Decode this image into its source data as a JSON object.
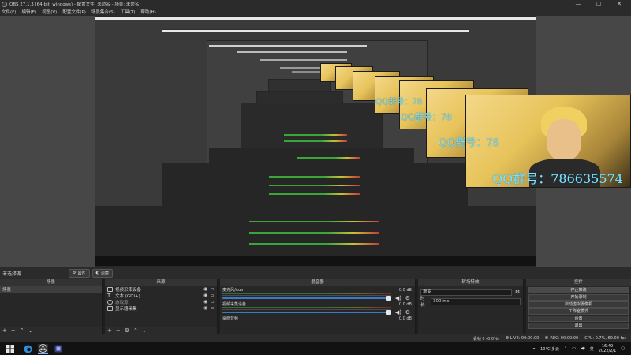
{
  "window": {
    "title": "OBS 27.1.3 (64-bit, windows) - 配置文件: 未命名 - 场景: 未命名",
    "minimize": "—",
    "maximize": "☐",
    "close": "✕"
  },
  "menu": [
    "文件(F)",
    "编辑(E)",
    "视图(V)",
    "配置文件(P)",
    "场景集合(S)",
    "工具(T)",
    "帮助(H)"
  ],
  "preview": {
    "overlay_texts": [
      "QQ群号：78",
      "QQ群号：78",
      "QQ群号：78",
      "QQ群号：786635574"
    ]
  },
  "scene_bar": {
    "name": "未选择源",
    "properties_label": "属性",
    "filters_label": "滤镜"
  },
  "scenes": {
    "header": "场景",
    "items": [
      "场景"
    ]
  },
  "sources": {
    "header": "来源",
    "items": [
      {
        "name": "视频采集设备",
        "icon": "camera-icon"
      },
      {
        "name": "文本 (GDI+)",
        "icon": "text-icon"
      },
      {
        "name": "游戏源",
        "icon": "gamepad-icon"
      },
      {
        "name": "显示器采集",
        "icon": "monitor-icon"
      }
    ]
  },
  "mixer": {
    "header": "混音器",
    "tracks": [
      {
        "name": "麦克风/Aux",
        "db": "0.0 dB",
        "level": 0.7
      },
      {
        "name": "视频采集设备",
        "db": "0.0 dB",
        "level": 0.7
      },
      {
        "name": "桌面音频",
        "db": "0.0 dB",
        "level": 0.7
      }
    ]
  },
  "transitions": {
    "header": "转场特效",
    "type": "渐变",
    "duration_label": "时长",
    "duration_value": "300 ms"
  },
  "controls": {
    "header": "控件",
    "buttons": [
      "停止推流",
      "开始录制",
      "启动虚拟摄像机",
      "工作室模式",
      "设置",
      "退出"
    ]
  },
  "status": {
    "dropped": "丢帧 0 (0.0%)",
    "live": "LIVE: 00:00:00",
    "rec": "REC: 00:00:00",
    "cpu": "CPU: 0.7%, 60.00 fps"
  },
  "taskbar": {
    "weather": "10°C 多云",
    "ime": "英",
    "time": "16:49",
    "date": "2022/2/1"
  },
  "colors": {
    "overlay_text": "#7fe3ff",
    "slider": "#3c79c9",
    "panel_bg": "#272727"
  }
}
